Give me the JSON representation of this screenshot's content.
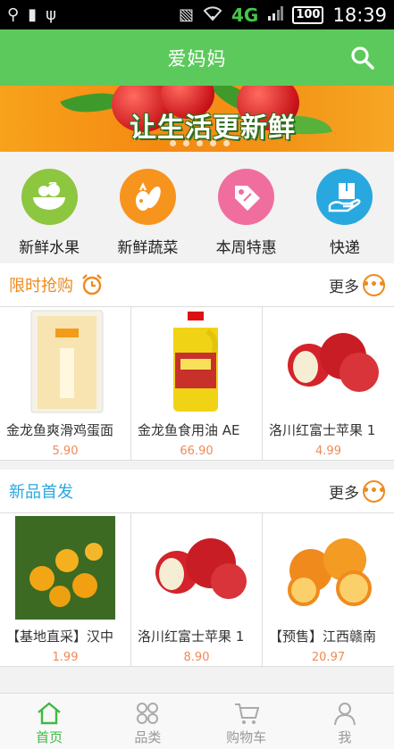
{
  "status_bar": {
    "network": "4G",
    "battery": "100",
    "time": "18:39"
  },
  "header": {
    "title": "爱妈妈"
  },
  "banner": {
    "slogan": "让生活更新鲜"
  },
  "categories": [
    {
      "label": "新鲜水果",
      "color": "#8dc63f",
      "icon": "fruit-bowl-icon"
    },
    {
      "label": "新鲜蔬菜",
      "color": "#f7941d",
      "icon": "vegetable-icon"
    },
    {
      "label": "本周特惠",
      "color": "#f06e9e",
      "icon": "price-tag-icon"
    },
    {
      "label": "快递",
      "color": "#29a8e0",
      "icon": "delivery-box-icon"
    }
  ],
  "sections": {
    "flash_sale": {
      "title": "限时抢购",
      "title_color": "#f08a1c",
      "more_label": "更多",
      "items": [
        {
          "name": "金龙鱼爽滑鸡蛋面",
          "price": "5.90"
        },
        {
          "name": "金龙鱼食用油 AE",
          "price": "66.90"
        },
        {
          "name": "洛川红富士苹果 1",
          "price": "4.99"
        }
      ]
    },
    "new_arrivals": {
      "title": "新品首发",
      "title_color": "#29a8e0",
      "more_label": "更多",
      "items": [
        {
          "name": "【基地直采】汉中",
          "price": "1.99"
        },
        {
          "name": "洛川红富士苹果 1",
          "price": "8.90"
        },
        {
          "name": "【预售】江西赣南",
          "price": "20.97"
        }
      ]
    }
  },
  "tabbar": {
    "active_color": "#41b843",
    "tabs": [
      {
        "label": "首页"
      },
      {
        "label": "品类"
      },
      {
        "label": "购物车"
      },
      {
        "label": "我"
      }
    ]
  }
}
